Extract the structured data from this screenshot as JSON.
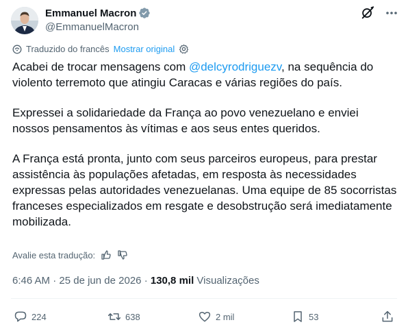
{
  "author": {
    "display_name": "Emmanuel Macron",
    "handle": "@EmmanuelMacron"
  },
  "translation": {
    "note": "Traduzido do francês",
    "show_original": "Mostrar original"
  },
  "post": {
    "p1_before": "Acabei de trocar mensagens com ",
    "p1_mention": "@delcyrodriguezv",
    "p1_after": ", na sequência do violento terremoto que atingiu Caracas e várias regiões do país.",
    "p2": "Expressei a solidariedade da França ao povo venezuelano e enviei nossos pensamentos às vítimas e aos seus entes queridos.",
    "p3": "A França está pronta, junto com seus parceiros europeus, para prestar assistência às populações afetadas, em resposta às necessidades expressas pelas autoridades venezuelanas. Uma equipe de 85 socorristas franceses especializados em resgate e desobstrução será imediatamente mobilizada."
  },
  "rate_translation": "Avalie esta tradução:",
  "meta": {
    "time": "6:46 AM",
    "separator": " · ",
    "date": "25 de jun de 2026",
    "views_count": "130,8 mil",
    "views_label": "Visualizações"
  },
  "actions": {
    "replies": "224",
    "reposts": "638",
    "likes": "2 mil",
    "bookmarks": "53"
  },
  "colors": {
    "accent": "#1d9bf0",
    "text": "#0f1419",
    "secondary": "#536471"
  }
}
